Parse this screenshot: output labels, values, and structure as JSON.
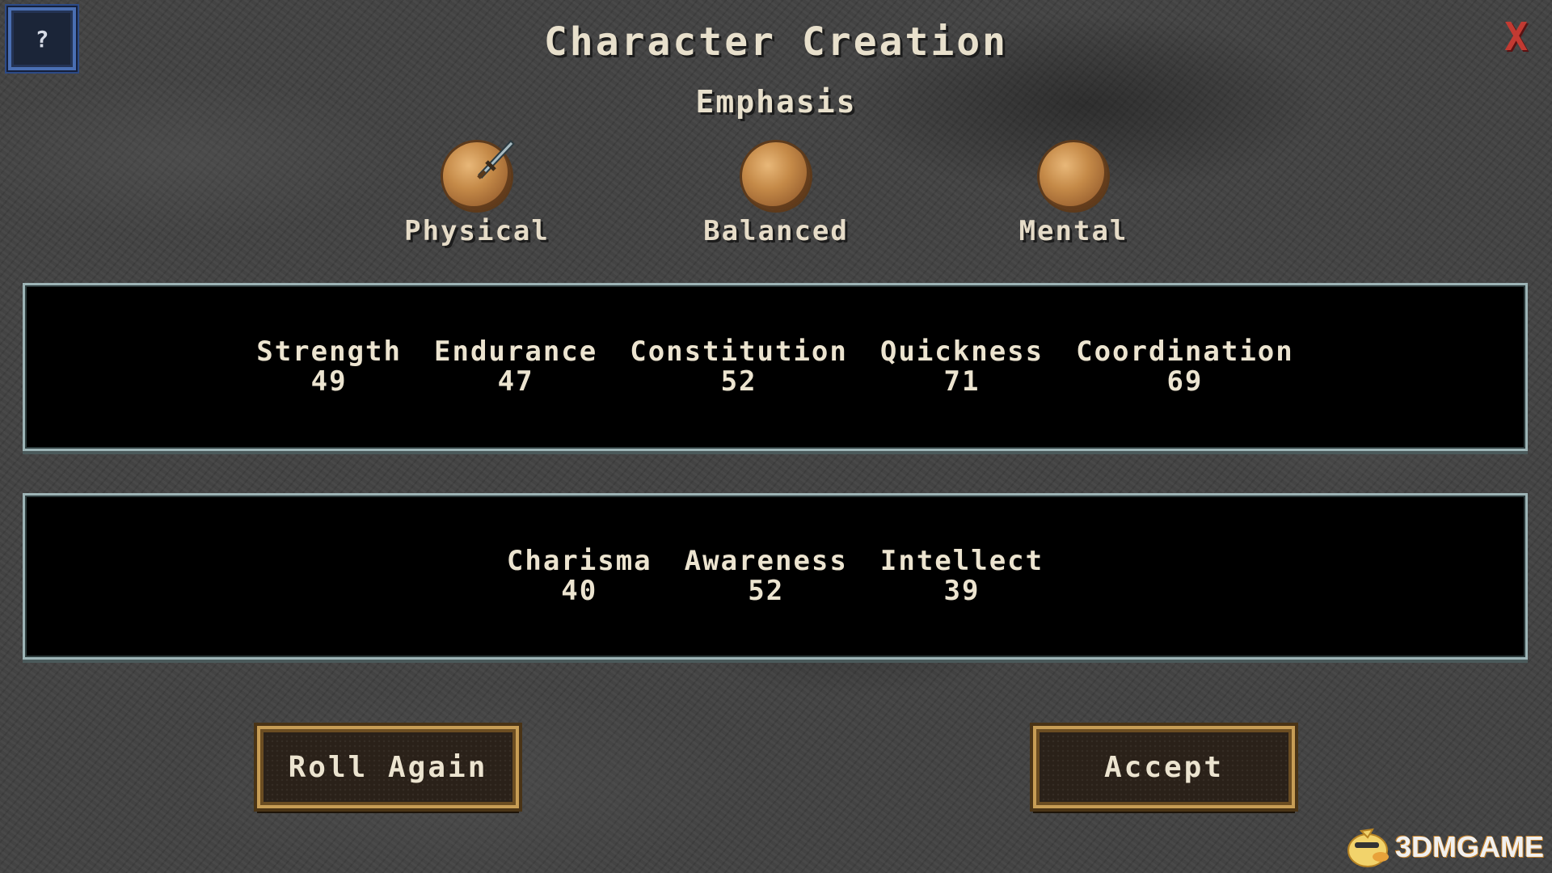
{
  "window": {
    "title": "Character Creation",
    "help_label": "?",
    "close_label": "X"
  },
  "emphasis": {
    "heading": "Emphasis",
    "options": [
      {
        "label": "Physical",
        "icon": "orb-with-sword-icon",
        "selected": true
      },
      {
        "label": "Balanced",
        "icon": "orb-icon"
      },
      {
        "label": "Mental",
        "icon": "orb-icon"
      }
    ]
  },
  "physical_stats": [
    {
      "name": "Strength",
      "value": "49"
    },
    {
      "name": "Endurance",
      "value": "47"
    },
    {
      "name": "Constitution",
      "value": "52"
    },
    {
      "name": "Quickness",
      "value": "71"
    },
    {
      "name": "Coordination",
      "value": "69"
    }
  ],
  "mental_stats": [
    {
      "name": "Charisma",
      "value": "40"
    },
    {
      "name": "Awareness",
      "value": "52"
    },
    {
      "name": "Intellect",
      "value": "39"
    }
  ],
  "actions": {
    "roll_again_label": "Roll Again",
    "accept_label": "Accept"
  },
  "watermark": {
    "text": "3DMGAME"
  },
  "colors": {
    "background": "#414141",
    "text": "#e6dcc8",
    "close": "#c23a32",
    "panel_border": "#9db4b6",
    "button_border": "#c79d55",
    "orb": "#c58a48"
  }
}
